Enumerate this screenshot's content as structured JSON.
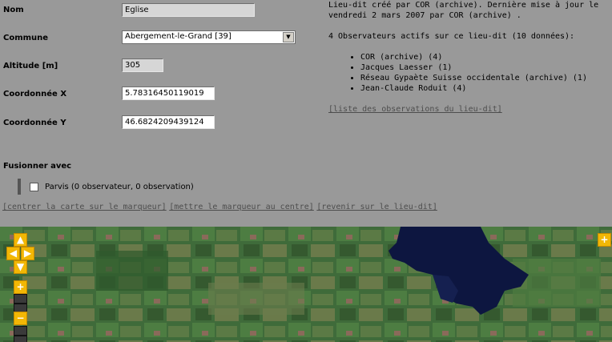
{
  "form": {
    "nom": {
      "label": "Nom",
      "value": "Eglise"
    },
    "commune": {
      "label": "Commune",
      "value": "Abergement-le-Grand [39]"
    },
    "altitude": {
      "label": "Altitude [m]",
      "value": "305"
    },
    "coord_x": {
      "label": "Coordonnée X",
      "value": "5.78316450119019"
    },
    "coord_y": {
      "label": "Coordonnée Y",
      "value": "46.6824209439124"
    }
  },
  "merge": {
    "title": "Fusionner avec",
    "option": "Parvis (0 observateur, 0 observation)"
  },
  "actions": {
    "center": "[centrer la carte sur le marqueur]",
    "move": "[mettre le marqueur au centre]",
    "back": "[revenir sur le lieu-dit]"
  },
  "info": {
    "line1": "Lieu-dit créé par COR (archive). Dernière mise à jour le",
    "line2": "vendredi 2 mars 2007 par COR (archive) .",
    "observers_heading": "4 Observateurs actifs sur ce lieu-dit (10 données):",
    "observers": [
      "COR (archive) (4)",
      "Jacques Laesser (1)",
      "Réseau Gypaète Suisse occidentale (archive) (1)",
      "Jean-Claude Roduit (4)"
    ],
    "list_link": "[liste des observations du lieu-dit]"
  },
  "map": {
    "pan_up": "▲",
    "pan_left": "◀",
    "pan_right": "▶",
    "pan_down": "▼",
    "zoom_in": "+",
    "zoom_out": "−",
    "layers": "+"
  },
  "colors": {
    "background": "#999999",
    "control": "#f2b705",
    "lake": "#0d1640"
  }
}
